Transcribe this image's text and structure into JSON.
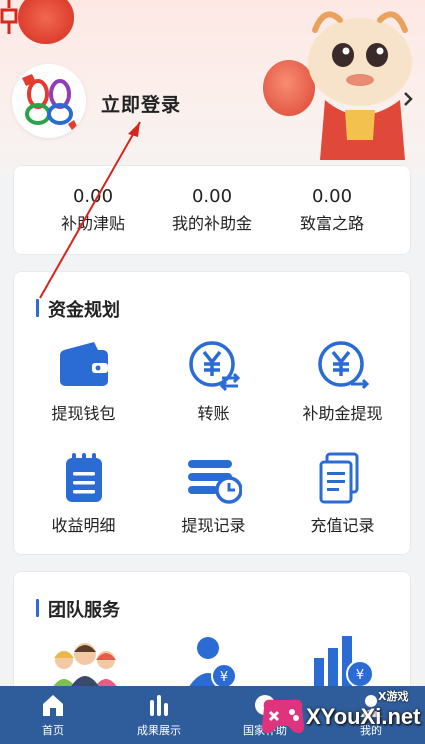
{
  "header": {
    "login_text": "立即登录"
  },
  "stats": [
    {
      "value": "0.00",
      "label": "补助津贴"
    },
    {
      "value": "0.00",
      "label": "我的补助金"
    },
    {
      "value": "0.00",
      "label": "致富之路"
    }
  ],
  "funds": {
    "title": "资金规划",
    "items": [
      {
        "label": "提现钱包",
        "icon": "wallet-icon"
      },
      {
        "label": "转账",
        "icon": "transfer-icon"
      },
      {
        "label": "补助金提现",
        "icon": "subsidy-withdraw-icon"
      },
      {
        "label": "收益明细",
        "icon": "income-detail-icon"
      },
      {
        "label": "提现记录",
        "icon": "withdraw-record-icon"
      },
      {
        "label": "充值记录",
        "icon": "recharge-record-icon"
      }
    ]
  },
  "team": {
    "title": "团队服务",
    "items": [
      {
        "icon": "team-people-icon"
      },
      {
        "icon": "user-money-icon"
      },
      {
        "icon": "chart-money-icon"
      }
    ]
  },
  "nav": [
    {
      "label": "首页",
      "icon": "home-icon"
    },
    {
      "label": "成果展示",
      "icon": "bar-chart-icon"
    },
    {
      "label": "国家补助",
      "icon": "national-icon"
    },
    {
      "label": "我的",
      "icon": "profile-icon"
    }
  ],
  "watermark": {
    "text": "XYouXi.net",
    "small": "X游戏"
  },
  "colors": {
    "accent": "#2b6cd4",
    "nav_bg": "#2f5d9c",
    "page_bg": "#f2f3f5"
  }
}
